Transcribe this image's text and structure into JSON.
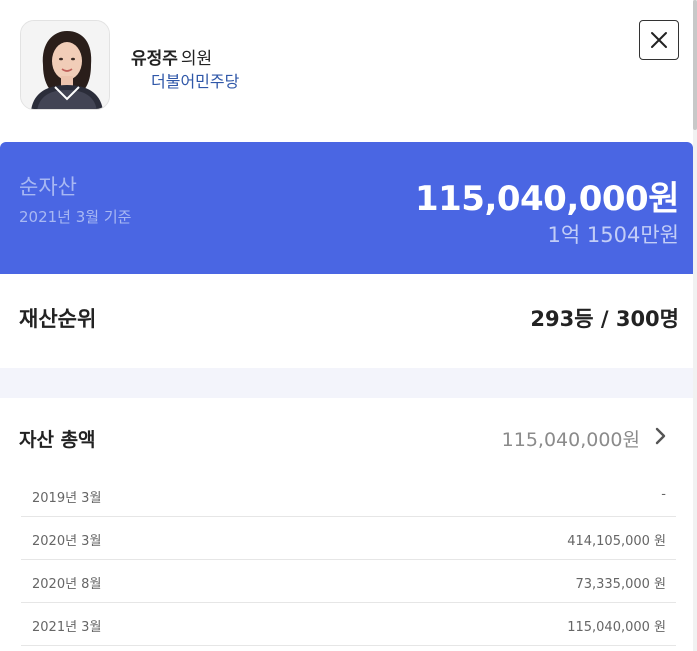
{
  "profile": {
    "name": "유정주",
    "title": "의원",
    "party": "더불어민주당"
  },
  "net_asset": {
    "label": "순자산",
    "date": "2021년 3월 기준",
    "amount": "115,040,000원",
    "amount_korean": "1억 1504만원",
    "banner_color": "#4a66e3"
  },
  "ranking": {
    "label": "재산순위",
    "value": "293등 / 300명"
  },
  "total_assets": {
    "label": "자산 총액",
    "value": "115,040,000원"
  },
  "history": [
    {
      "date": "2019년 3월",
      "amount": "-"
    },
    {
      "date": "2020년 3월",
      "amount": "414,105,000 원"
    },
    {
      "date": "2020년 8월",
      "amount": "73,335,000 원"
    },
    {
      "date": "2021년 3월",
      "amount": "115,040,000 원"
    }
  ],
  "icons": {
    "close": "close-icon",
    "chevron": "chevron-right-icon",
    "avatar": "avatar"
  },
  "colors": {
    "party": "#2f57a8",
    "muted": "#8b8b8b"
  }
}
